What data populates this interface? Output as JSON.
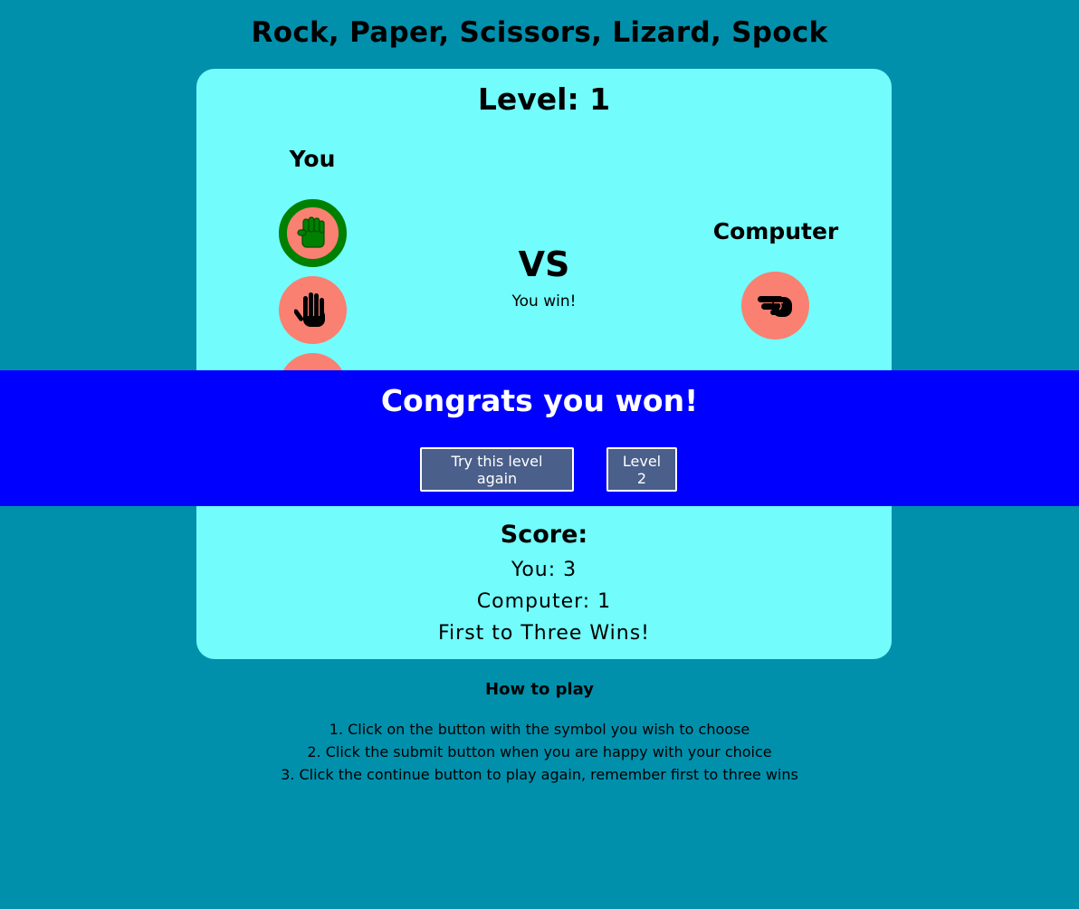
{
  "page": {
    "title": "Rock, Paper, Scissors, Lizard, Spock"
  },
  "game": {
    "level_label": "Level: 1",
    "player_label": "You",
    "computer_label": "Computer",
    "vs_label": "VS",
    "result": "You win!",
    "player_choices": [
      {
        "name": "rock",
        "icon": "fist-icon",
        "selected": true
      },
      {
        "name": "paper",
        "icon": "open-hand-icon",
        "selected": false
      },
      {
        "name": "scissors",
        "icon": "hand-icon",
        "selected": false
      }
    ],
    "computer_choice": {
      "name": "scissors",
      "icon": "scissors-hand-icon"
    },
    "colors": {
      "background": "#0090ac",
      "card": "#72fcfc",
      "choice_button": "#fa8072",
      "selected_border": "#008000",
      "banner": "#0000ff",
      "banner_button": "#4a5f8a"
    }
  },
  "score": {
    "title": "Score:",
    "player": "You: 3",
    "computer": "Computer: 1",
    "rule": "First to Three Wins!"
  },
  "win_banner": {
    "title": "Congrats you won!",
    "retry_label": "Try this level again",
    "next_label": "Level 2"
  },
  "how_to_play": {
    "title": "How to play",
    "steps": [
      "1. Click on the button with the symbol you wish to choose",
      "2. Click the submit button when you are happy with your choice",
      "3. Click the continue button to play again, remember first to three wins"
    ]
  }
}
